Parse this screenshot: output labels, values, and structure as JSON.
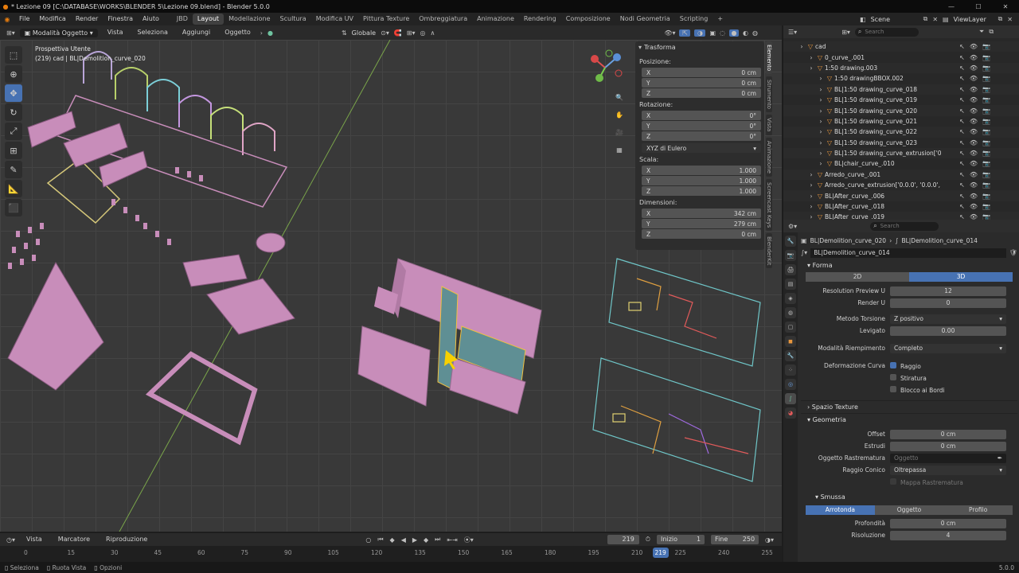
{
  "window": {
    "title": "* Lezione 09 [C:\\DATABASE\\WORKS\\BLENDER 5\\Lezione 09.blend] - Blender 5.0.0"
  },
  "menu": [
    "File",
    "Modifica",
    "Render",
    "Finestra",
    "Aiuto"
  ],
  "workspaces": [
    {
      "label": "JBD",
      "active": false
    },
    {
      "label": "Layout",
      "active": true
    },
    {
      "label": "Modellazione",
      "active": false
    },
    {
      "label": "Scultura",
      "active": false
    },
    {
      "label": "Modifica UV",
      "active": false
    },
    {
      "label": "Pittura Texture",
      "active": false
    },
    {
      "label": "Ombreggiatura",
      "active": false
    },
    {
      "label": "Animazione",
      "active": false
    },
    {
      "label": "Rendering",
      "active": false
    },
    {
      "label": "Composizione",
      "active": false
    },
    {
      "label": "Nodi Geometria",
      "active": false
    },
    {
      "label": "Scripting",
      "active": false
    }
  ],
  "add_workspace": "+",
  "scene": {
    "label": "Scene",
    "viewlayer": "ViewLayer"
  },
  "viewport_header": {
    "mode": "Modalità Oggetto",
    "menus": [
      "Vista",
      "Seleziona",
      "Aggiungi",
      "Oggetto"
    ],
    "orientation": "Globale"
  },
  "viewport": {
    "line1": "Prospettiva Utente",
    "line2": "(219) cad | BL|Demolition_curve_020"
  },
  "npanel": {
    "title": "Trasforma",
    "location_label": "Posizione:",
    "location": [
      {
        "axis": "X",
        "value": "0 cm"
      },
      {
        "axis": "Y",
        "value": "0 cm"
      },
      {
        "axis": "Z",
        "value": "0 cm"
      }
    ],
    "rotation_label": "Rotazione:",
    "rotation": [
      {
        "axis": "X",
        "value": "0°"
      },
      {
        "axis": "Y",
        "value": "0°"
      },
      {
        "axis": "Z",
        "value": "0°"
      }
    ],
    "rotation_mode": "XYZ di Eulero",
    "scale_label": "Scala:",
    "scale": [
      {
        "axis": "X",
        "value": "1.000"
      },
      {
        "axis": "Y",
        "value": "1.000"
      },
      {
        "axis": "Z",
        "value": "1.000"
      }
    ],
    "dimensions_label": "Dimensioni:",
    "dimensions": [
      {
        "axis": "X",
        "value": "342 cm"
      },
      {
        "axis": "Y",
        "value": "279 cm"
      },
      {
        "axis": "Z",
        "value": "0 cm"
      }
    ]
  },
  "side_tabs": [
    "Elemento",
    "Strumento",
    "Vista",
    "Animazione",
    "Screencast Keys",
    "BlenderKit"
  ],
  "outliner": {
    "search_placeholder": "Search",
    "rows": [
      {
        "indent": 1,
        "name": "cad"
      },
      {
        "indent": 2,
        "name": "0_curve_.001"
      },
      {
        "indent": 2,
        "name": "1:50 drawing.003"
      },
      {
        "indent": 3,
        "name": "1:50 drawingBBOX.002"
      },
      {
        "indent": 3,
        "name": "BL|1:50 drawing_curve_018"
      },
      {
        "indent": 3,
        "name": "BL|1:50 drawing_curve_019"
      },
      {
        "indent": 3,
        "name": "BL|1:50 drawing_curve_020"
      },
      {
        "indent": 3,
        "name": "BL|1:50 drawing_curve_021"
      },
      {
        "indent": 3,
        "name": "BL|1:50 drawing_curve_022"
      },
      {
        "indent": 3,
        "name": "BL|1:50 drawing_curve_023"
      },
      {
        "indent": 3,
        "name": "BL|1:50 drawing_curve_extrusion['0"
      },
      {
        "indent": 3,
        "name": "BL|chair_curve_.010"
      },
      {
        "indent": 2,
        "name": "Arredo_curve_.001"
      },
      {
        "indent": 2,
        "name": "Arredo_curve_extrusion['0.0.0', '0.0.0',"
      },
      {
        "indent": 2,
        "name": "BL|After_curve_.006"
      },
      {
        "indent": 2,
        "name": "BL|After_curve_.018"
      },
      {
        "indent": 2,
        "name": "BL|After_curve_.019"
      }
    ]
  },
  "properties": {
    "search_placeholder": "Search",
    "breadcrumb": [
      "BL|Demolition_curve_020",
      "BL|Demolition_curve_014"
    ],
    "datablock": "BL|Demolition_curve_014",
    "forma": {
      "title": "Forma",
      "dims": [
        "2D",
        "3D"
      ],
      "resolution_preview_label": "Resolution Preview U",
      "resolution_preview": "12",
      "render_u_label": "Render U",
      "render_u": "0",
      "twist_label": "Metodo Torsione",
      "twist": "Z positivo",
      "smooth_label": "Levigato",
      "smooth": "0.00",
      "fill_label": "Modalità Riempimento",
      "fill": "Completo",
      "deform_label": "Deformazione Curva",
      "deform_options": [
        "Raggio",
        "Stiratura",
        "Blocco ai Bordi"
      ]
    },
    "texture_space": "Spazio Texture",
    "geometria": {
      "title": "Geometria",
      "offset_label": "Offset",
      "offset": "0 cm",
      "extrude_label": "Estrudi",
      "extrude": "0 cm",
      "taper_label": "Oggetto Rastrematura",
      "taper_placeholder": "Oggetto",
      "taper_radius_label": "Raggio Conico",
      "taper_radius": "Oltrepassa",
      "taper_map": "Mappa Rastrematura"
    },
    "bevel": {
      "title": "Smussa",
      "modes": [
        "Arrotonda",
        "Oggetto",
        "Profilo"
      ],
      "depth_label": "Profondità",
      "depth": "0 cm",
      "resolution_label": "Risoluzione",
      "resolution": "4"
    }
  },
  "timeline": {
    "menus": [
      "Vista",
      "Marcatore",
      "Riproduzione"
    ],
    "current": "219",
    "start_label": "Inizio",
    "start": "1",
    "end_label": "Fine",
    "end": "250",
    "ticks": [
      "0",
      "15",
      "30",
      "45",
      "60",
      "75",
      "90",
      "105",
      "120",
      "135",
      "150",
      "165",
      "180",
      "195",
      "210",
      "225",
      "240",
      "255"
    ],
    "playhead": "219"
  },
  "status": {
    "items": [
      "Seleziona",
      "Ruota Vista",
      "Opzioni"
    ],
    "version": "5.0.0"
  },
  "colors": {
    "accent": "#4772b3",
    "object": "#c88dba",
    "selected_wall": "#5f8f94"
  }
}
